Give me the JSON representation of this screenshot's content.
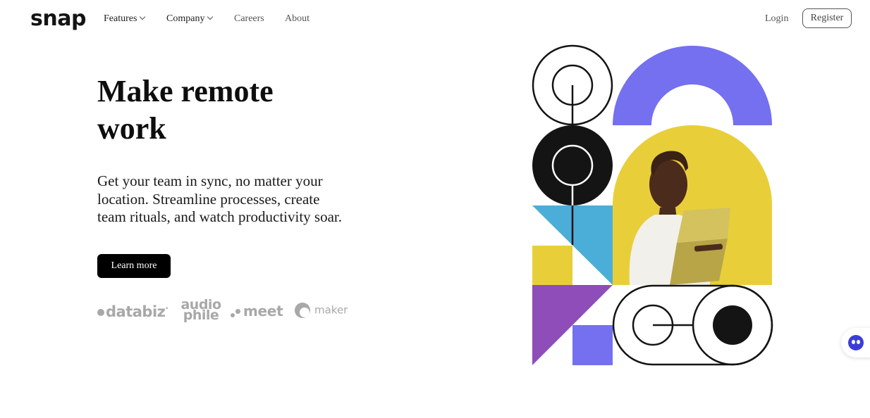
{
  "brand": {
    "logo": "snap"
  },
  "nav": {
    "features": "Features",
    "company": "Company",
    "careers": "Careers",
    "about": "About",
    "login": "Login",
    "register": "Register"
  },
  "hero": {
    "title": "Make remote work",
    "description": "Get your team in sync, no matter your location. Streamline processes, create team rituals, and watch productivity soar.",
    "cta": "Learn more"
  },
  "clients": {
    "databiz": "databiz",
    "audiophile_top": "audio",
    "audiophile_bottom": "phile",
    "meet": "meet",
    "maker": "maker"
  },
  "colors": {
    "purple": "#7470ef",
    "yellow": "#e8cf3a",
    "blue": "#4aaed8",
    "violet": "#8e4db9",
    "black": "#141414"
  },
  "icons": {
    "chat": "chat-bot-icon",
    "chevron": "chevron-down-icon"
  }
}
